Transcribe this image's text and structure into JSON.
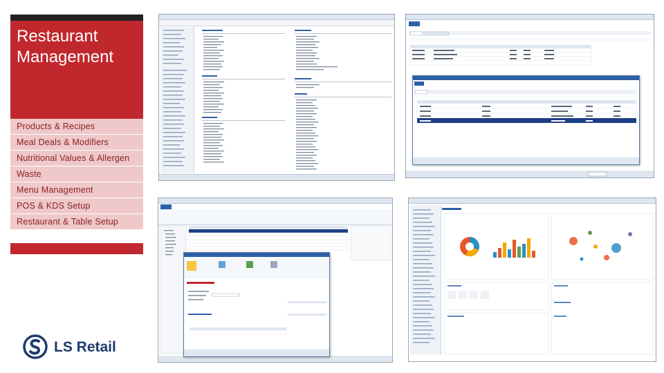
{
  "title": "Restaurant Management",
  "menu": [
    "Products & Recipes",
    "Meal Deals & Modifiers",
    "Nutritional Values & Allergen",
    "Waste",
    "Menu Management",
    "POS & KDS Setup",
    "Restaurant & Table Setup"
  ],
  "logo": {
    "text": "LS Retail"
  },
  "colors": {
    "brand_red": "#c1282d",
    "menu_pink": "#efc9c9",
    "menu_text": "#8a1f22",
    "logo_blue": "#1e3a6e",
    "ax_blue": "#2d5fa6"
  },
  "screenshots": [
    {
      "name": "navigation-area-page"
    },
    {
      "name": "bill-of-materials"
    },
    {
      "name": "item-nutrition"
    },
    {
      "name": "role-center-charts"
    }
  ]
}
